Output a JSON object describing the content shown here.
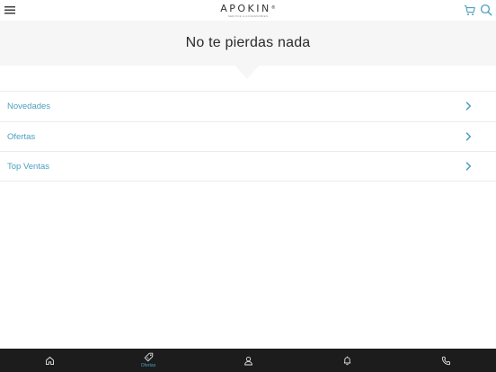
{
  "header": {
    "logo_text": "APOKIN",
    "logo_mark": "®",
    "logo_tagline": "SERVICE & ACCESSORIES"
  },
  "banner": {
    "title": "No te pierdas nada"
  },
  "list": {
    "items": [
      {
        "label": "Novedades"
      },
      {
        "label": "Ofertas"
      },
      {
        "label": "Top Ventas"
      }
    ]
  },
  "bottom_nav": {
    "items": [
      {
        "icon": "home-icon",
        "label": ""
      },
      {
        "icon": "tag-icon",
        "label": "Ofertas",
        "active": true
      },
      {
        "icon": "user-icon",
        "label": ""
      },
      {
        "icon": "bell-icon",
        "label": ""
      },
      {
        "icon": "phone-icon",
        "label": ""
      }
    ]
  },
  "colors": {
    "accent": "#4a9fc0",
    "nav_background": "#1c1c1c",
    "banner_background": "#f6f6f6",
    "text_dark": "#2a2a2a"
  }
}
